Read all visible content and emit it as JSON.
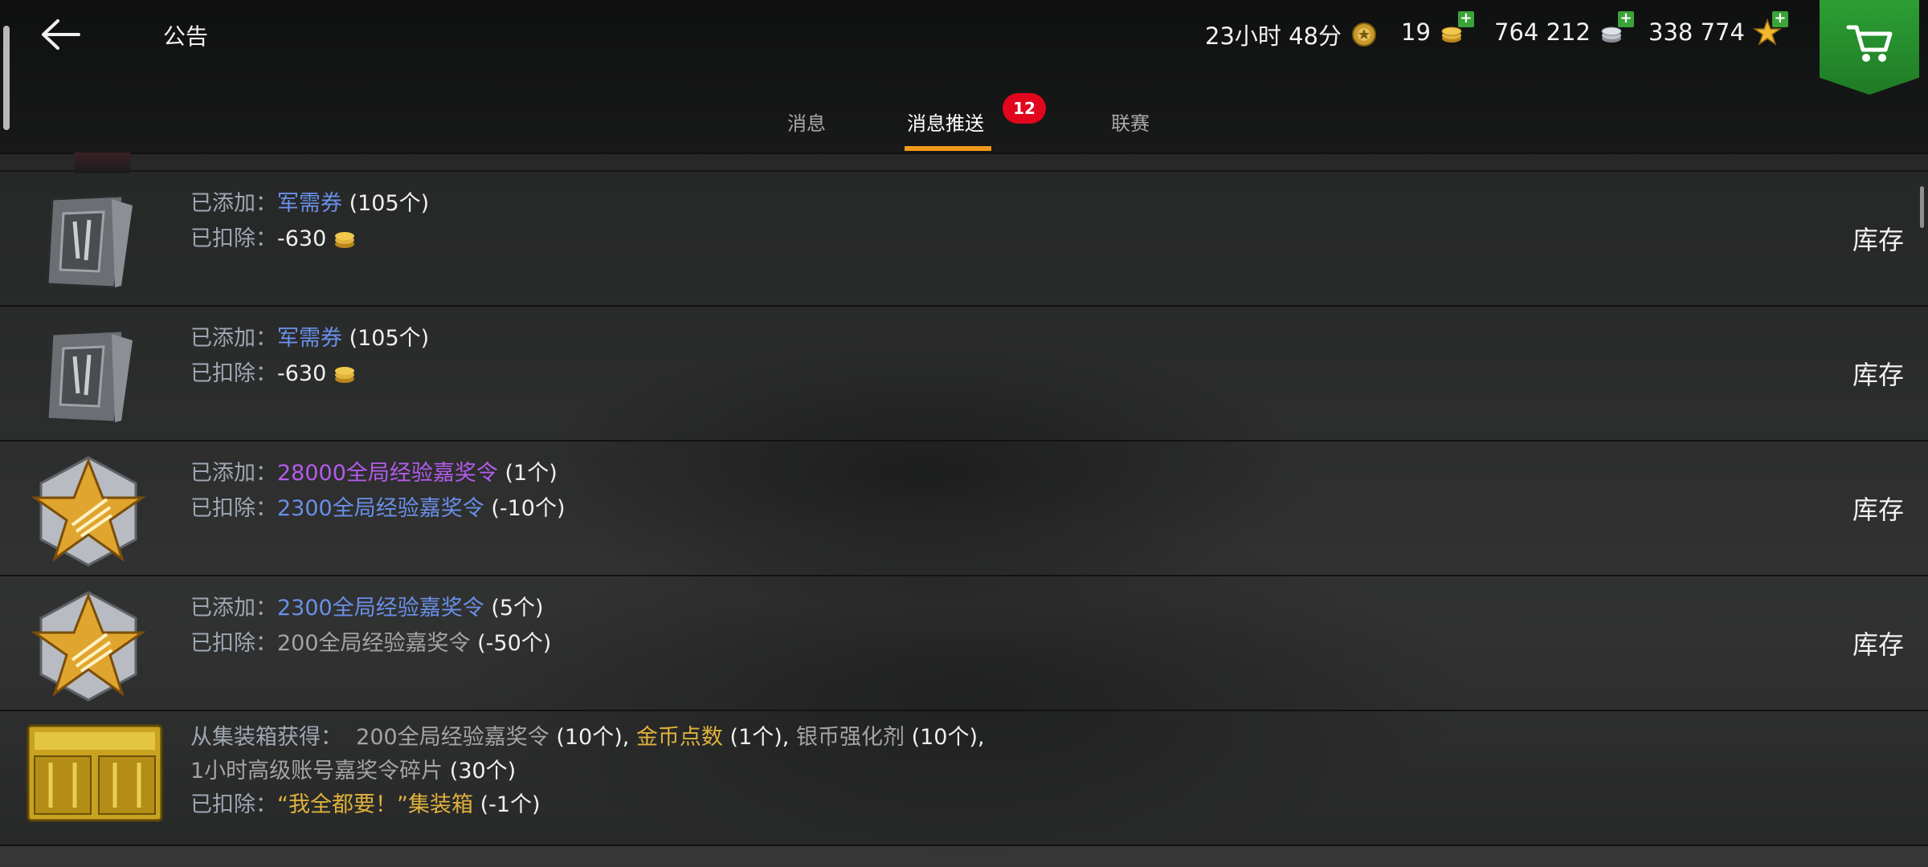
{
  "header": {
    "title": "公告",
    "timer": "23小时 48分",
    "gold": "19",
    "silver": "764 212",
    "free_xp": "338 774"
  },
  "tabs": [
    {
      "label": "消息"
    },
    {
      "label": "消息推送",
      "badge": "12"
    },
    {
      "label": "联赛"
    }
  ],
  "colors": {
    "accent": "#f2991a",
    "badge": "#e1061d",
    "cart": "#2d9e34",
    "link_blue": "#6a8fe8",
    "purple": "#b35bea",
    "gold": "#e0b13c"
  },
  "messages": [
    {
      "icon": "ticket-icon",
      "added_label": "已添加：",
      "added_item": "军需券",
      "added_qty": "(105个)",
      "deducted_label": "已扣除：",
      "deducted_value": "-630",
      "action": "库存"
    },
    {
      "icon": "ticket-icon",
      "added_label": "已添加：",
      "added_item": "军需券",
      "added_qty": "(105个)",
      "deducted_label": "已扣除：",
      "deducted_value": "-630",
      "action": "库存"
    },
    {
      "icon": "xp-star-icon",
      "added_label": "已添加：",
      "added_item": "28000全局经验嘉奖令",
      "added_qty": "(1个)",
      "deducted_label": "已扣除：",
      "deducted_item": "2300全局经验嘉奖令",
      "deducted_qty": "(-10个)",
      "action": "库存"
    },
    {
      "icon": "xp-star-icon",
      "added_label": "已添加：",
      "added_item": "2300全局经验嘉奖令",
      "added_qty": "(5个)",
      "deducted_label": "已扣除：",
      "deducted_item": "200全局经验嘉奖令",
      "deducted_qty": "(-50个)",
      "action": "库存"
    },
    {
      "icon": "crate-icon",
      "obtained_label": "从集装箱获得：",
      "item1": "200全局经验嘉奖令",
      "item1_qty": "(10个)",
      "item2": "金币点数",
      "item2_qty": "(1个)",
      "item3": "银币强化剂",
      "item3_qty": "(10个)",
      "item4": "1小时高级账号嘉奖令碎片",
      "item4_qty": "(30个)",
      "comma": ",",
      "deducted_label": "已扣除：",
      "deducted_item": "“我全都要！”集装箱",
      "deducted_qty": "(-1个)"
    }
  ]
}
